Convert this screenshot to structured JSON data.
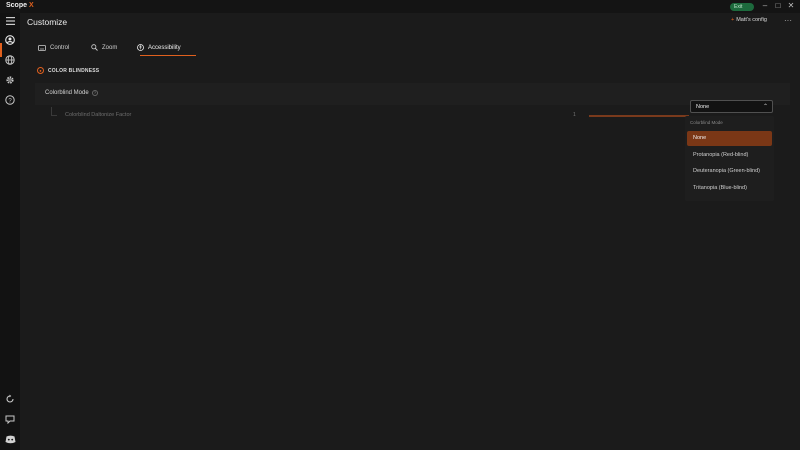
{
  "app": {
    "name_main": "Scope",
    "name_accent": "X",
    "exit_label": "Exit",
    "config_label": "Matt's config",
    "more_icon": "more-icon",
    "page_title": "Customize"
  },
  "window_controls": {
    "minimize": "–",
    "maximize": "□",
    "close": "✕"
  },
  "tabs": [
    {
      "label": "Control",
      "icon": "gamepad-icon"
    },
    {
      "label": "Zoom",
      "icon": "search-icon"
    },
    {
      "label": "Accessibility",
      "icon": "accessibility-icon",
      "active": true
    }
  ],
  "section": {
    "title": "COLOR BLINDNESS",
    "icon": "eye-icon"
  },
  "setting": {
    "label": "Colorblind Mode",
    "help_icon": "?",
    "selected_value": "None",
    "chevron": "⌃"
  },
  "subsetting": {
    "label": "Colorblind Daltonize Factor",
    "value": "1"
  },
  "dropdown": {
    "header": "Colorblind Mode",
    "options": [
      "None",
      "Protanopia (Red-blind)",
      "Deuteranopia (Green-blind)",
      "Tritanopia (Blue-blind)"
    ],
    "selected_index": 0
  },
  "colors": {
    "accent": "#e0601e",
    "selected_option": "#7a3716",
    "exit_badge": "#1d6a3d"
  }
}
